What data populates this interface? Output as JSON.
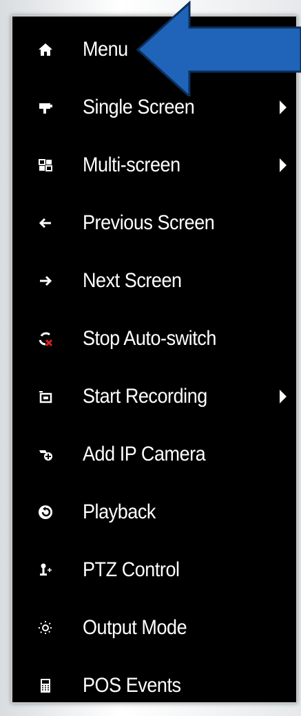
{
  "menu": {
    "items": [
      {
        "label": "Menu",
        "icon": "home-icon"
      },
      {
        "label": "Single Screen",
        "icon": "camera-icon",
        "submenu": true
      },
      {
        "label": "Multi-screen",
        "icon": "multiscreen-icon",
        "submenu": true
      },
      {
        "label": "Previous Screen",
        "icon": "arrow-left-icon"
      },
      {
        "label": "Next Screen",
        "icon": "arrow-right-icon"
      },
      {
        "label": "Stop Auto-switch",
        "icon": "stop-auto-switch-icon"
      },
      {
        "label": "Start Recording",
        "icon": "record-icon",
        "submenu": true
      },
      {
        "label": "Add IP Camera",
        "icon": "add-camera-icon"
      },
      {
        "label": "Playback",
        "icon": "playback-icon"
      },
      {
        "label": "PTZ Control",
        "icon": "ptz-icon"
      },
      {
        "label": "Output Mode",
        "icon": "output-mode-icon"
      },
      {
        "label": "POS Events",
        "icon": "pos-icon"
      }
    ]
  },
  "colors": {
    "menu_background": "#000000",
    "menu_text": "#ffffff",
    "callout_arrow": "#1f64b8",
    "stop_x": "#e02020"
  }
}
